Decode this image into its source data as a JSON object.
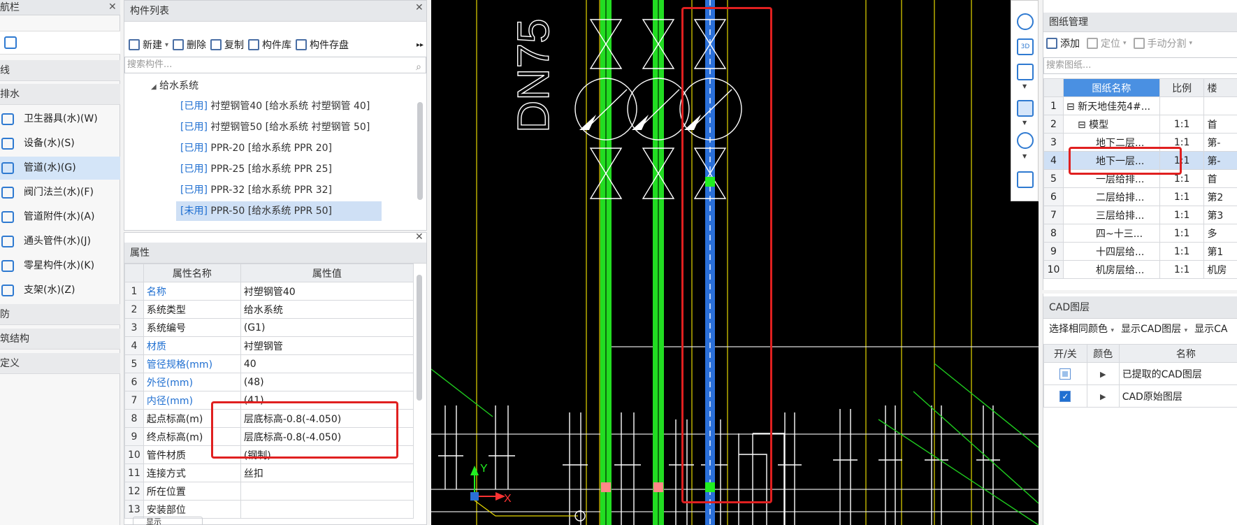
{
  "nav": {
    "title": "航栏",
    "groups": [
      "线",
      "排水",
      "防",
      "筑结构",
      "定义"
    ],
    "items": [
      {
        "label": "卫生器具(水)(W)",
        "icon": "sanitary-fixture-icon"
      },
      {
        "label": "设备(水)(S)",
        "icon": "equipment-icon"
      },
      {
        "label": "管道(水)(G)",
        "icon": "pipe-icon"
      },
      {
        "label": "阀门法兰(水)(F)",
        "icon": "valve-flange-icon"
      },
      {
        "label": "管道附件(水)(A)",
        "icon": "pipe-accessory-icon"
      },
      {
        "label": "通头管件(水)(J)",
        "icon": "tee-fitting-icon"
      },
      {
        "label": "零星构件(水)(K)",
        "icon": "misc-component-icon"
      },
      {
        "label": "支架(水)(Z)",
        "icon": "support-icon"
      }
    ]
  },
  "component_list": {
    "title": "构件列表",
    "toolbar": {
      "new": "新建",
      "delete": "删除",
      "copy": "复制",
      "library": "构件库",
      "save": "构件存盘",
      "more": "▸▸"
    },
    "search_placeholder": "搜索构件...",
    "tree_root": "给水系统",
    "items": [
      {
        "tag": "[已用]",
        "text": " 衬塑钢管40 [给水系统 衬塑钢管 40]"
      },
      {
        "tag": "[已用]",
        "text": " 衬塑钢管50 [给水系统 衬塑钢管 50]"
      },
      {
        "tag": "[已用]",
        "text": " PPR-20 [给水系统 PPR 20]"
      },
      {
        "tag": "[已用]",
        "text": " PPR-25 [给水系统 PPR 25]"
      },
      {
        "tag": "[已用]",
        "text": " PPR-32 [给水系统 PPR 32]"
      },
      {
        "tag": "[未用]",
        "text": " PPR-50 [给水系统 PPR 50]"
      }
    ]
  },
  "properties": {
    "title": "属性",
    "col_name": "属性名称",
    "col_value": "属性值",
    "rows": [
      {
        "idx": "1",
        "name": "名称",
        "value": "衬塑钢管40"
      },
      {
        "idx": "2",
        "name": "系统类型",
        "value": "给水系统"
      },
      {
        "idx": "3",
        "name": "系统编号",
        "value": "(G1)"
      },
      {
        "idx": "4",
        "name": "材质",
        "value": "衬塑钢管"
      },
      {
        "idx": "5",
        "name": "管径规格(mm)",
        "value": "40"
      },
      {
        "idx": "6",
        "name": "外径(mm)",
        "value": "(48)"
      },
      {
        "idx": "7",
        "name": "内径(mm)",
        "value": "(41)"
      },
      {
        "idx": "8",
        "name": "起点标高(m)",
        "value": "层底标高-0.8(-4.050)"
      },
      {
        "idx": "9",
        "name": "终点标高(m)",
        "value": "层底标高-0.8(-4.050)"
      },
      {
        "idx": "10",
        "name": "管件材质",
        "value": "(钢制)"
      },
      {
        "idx": "11",
        "name": "连接方式",
        "value": "丝扣"
      },
      {
        "idx": "12",
        "name": "所在位置",
        "value": ""
      },
      {
        "idx": "13",
        "name": "安装部位",
        "value": ""
      }
    ],
    "bottom_btn": "显示"
  },
  "canvas": {
    "label": "DN75",
    "axis_x": "X",
    "axis_y": "Y"
  },
  "drawing_mgmt": {
    "title": "图纸管理",
    "toolbar": {
      "add": "添加",
      "locate": "定位",
      "split": "手动分割"
    },
    "search_placeholder": "搜索图纸...",
    "col_name": "图纸名称",
    "col_scale": "比例",
    "col_floor": "楼",
    "rows": [
      {
        "idx": "1",
        "name": "⊟ 新天地佳苑4#...",
        "scale": "",
        "floor": ""
      },
      {
        "idx": "2",
        "name": "⊟ 模型",
        "scale": "1:1",
        "floor": "首"
      },
      {
        "idx": "3",
        "name": "地下二层...",
        "scale": "1:1",
        "floor": "第-"
      },
      {
        "idx": "4",
        "name": "地下一层...",
        "scale": "1:1",
        "floor": "第-"
      },
      {
        "idx": "5",
        "name": "一层给排...",
        "scale": "1:1",
        "floor": "首"
      },
      {
        "idx": "6",
        "name": "二层给排...",
        "scale": "1:1",
        "floor": "第2"
      },
      {
        "idx": "7",
        "name": "三层给排...",
        "scale": "1:1",
        "floor": "第3"
      },
      {
        "idx": "8",
        "name": "四~十三...",
        "scale": "1:1",
        "floor": "多"
      },
      {
        "idx": "9",
        "name": "十四层给...",
        "scale": "1:1",
        "floor": "第1"
      },
      {
        "idx": "10",
        "name": "机房层给...",
        "scale": "1:1",
        "floor": "机房"
      }
    ]
  },
  "cad_layers": {
    "title": "CAD图层",
    "select_color": "选择相同颜色",
    "show_layers": "显示CAD图层",
    "show_more": "显示CA",
    "col_toggle": "开/关",
    "col_color": "颜色",
    "col_name": "名称",
    "rows": [
      {
        "name": "已提取的CAD图层",
        "state": "partial"
      },
      {
        "name": "CAD原始图层",
        "state": "on"
      }
    ]
  },
  "colors": {
    "accent": "#1f6fd1",
    "highlight": "#e02020",
    "pipe_green": "#22dd22",
    "pipe_blue": "#2a6fd8"
  }
}
